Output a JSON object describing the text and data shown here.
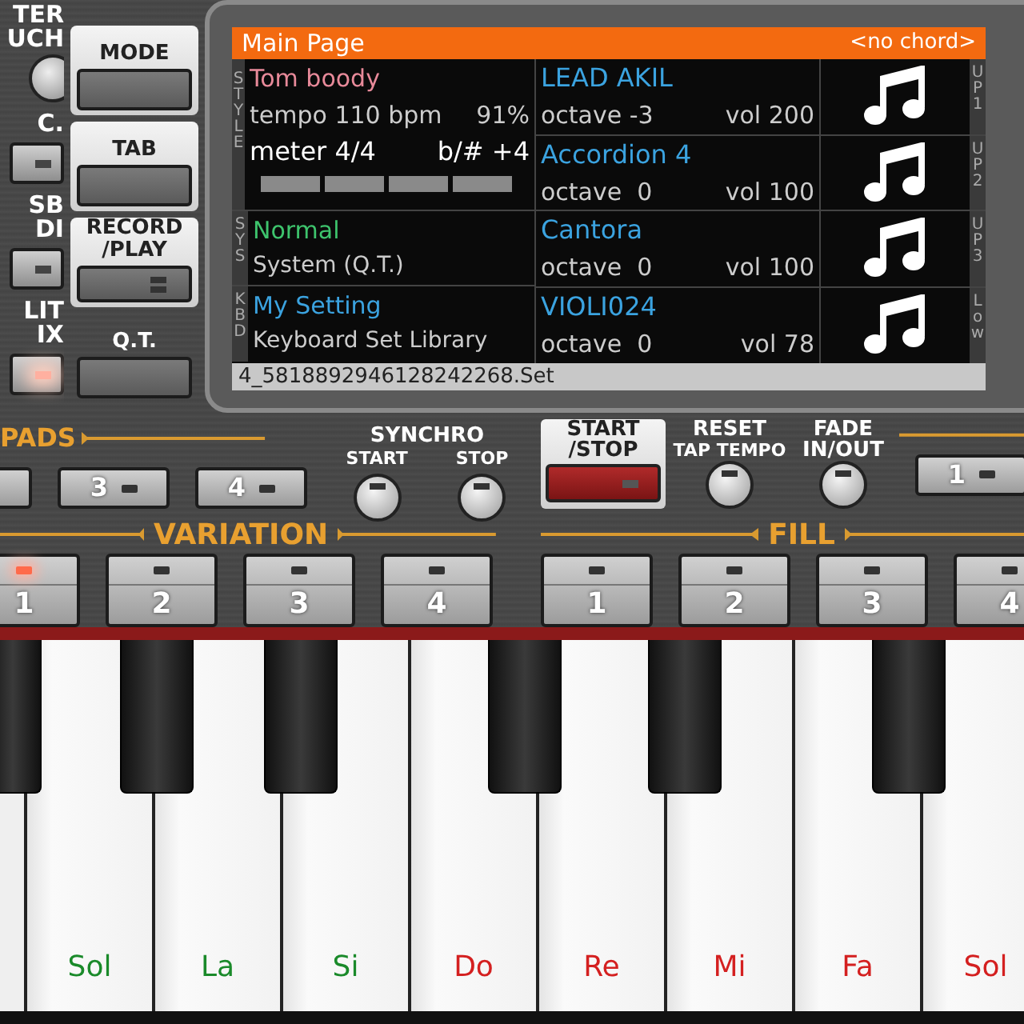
{
  "left_panel": [
    {
      "lines": [
        "TER",
        "UCH"
      ],
      "kind": "knob"
    },
    {
      "lines": [
        "C."
      ],
      "kind": "button",
      "lit": false
    },
    {
      "lines": [
        "SB",
        "DI"
      ],
      "kind": "button",
      "lit": false
    },
    {
      "lines": [
        "LIT",
        "IX"
      ],
      "kind": "button",
      "lit": true
    }
  ],
  "side_buttons": [
    {
      "lines": [
        "MODE"
      ],
      "kind": "plain"
    },
    {
      "lines": [
        "TAB"
      ],
      "kind": "plain"
    },
    {
      "lines": [
        "RECORD",
        "/PLAY"
      ],
      "kind": "led"
    },
    {
      "lines": [
        "Q.T."
      ],
      "kind": "plain"
    }
  ],
  "display": {
    "title": "Main Page",
    "chord": "<no chord>",
    "style": {
      "side": "STYLE",
      "name": "Tom boody",
      "tempo": "tempo 110 bpm",
      "percent": "91%",
      "meter": "meter 4/4",
      "transpose": "b/# +4"
    },
    "sys": {
      "side": "SYS",
      "name": "Normal",
      "detail": "System (Q.T.)"
    },
    "kbd": {
      "side": "KBD",
      "name": "My Setting",
      "detail": "Keyboard Set Library"
    },
    "parts": [
      {
        "side": "UP1",
        "name": "LEAD AKIL",
        "octave": "octave -3",
        "vol": "vol 200"
      },
      {
        "side": "UP2",
        "name": "Accordion 4",
        "octave": "octave  0",
        "vol": "vol 100"
      },
      {
        "side": "UP3",
        "name": "Cantora",
        "octave": "octave  0",
        "vol": "vol 100"
      },
      {
        "side": "Low",
        "name": "VIOLI024",
        "octave": "octave  0",
        "vol": "vol 78"
      }
    ],
    "file": "4_5818892946128242268.Set"
  },
  "pads": {
    "label": "PADS",
    "buttons": [
      "3",
      "4"
    ]
  },
  "synchro": {
    "label": "SYNCHRO",
    "knobs": [
      "START",
      "STOP"
    ]
  },
  "start_stop": {
    "lines": [
      "START",
      "/STOP"
    ]
  },
  "reset": {
    "lines": [
      "RESET",
      "TAP TEMPO"
    ]
  },
  "fade": {
    "lines": [
      "FADE",
      "IN/OUT"
    ]
  },
  "right_pad": {
    "label": "1"
  },
  "variation": {
    "label": "VARIATION",
    "buttons": [
      {
        "label": "1",
        "lit": true
      },
      {
        "label": "2",
        "lit": false
      },
      {
        "label": "3",
        "lit": false
      },
      {
        "label": "4",
        "lit": false
      }
    ]
  },
  "fill": {
    "label": "FILL",
    "buttons": [
      {
        "label": "1",
        "lit": false
      },
      {
        "label": "2",
        "lit": false
      },
      {
        "label": "3",
        "lit": false
      },
      {
        "label": "4",
        "lit": false
      }
    ]
  },
  "keys": [
    {
      "label": "Sol",
      "color": "#1a8a2a"
    },
    {
      "label": "La",
      "color": "#1a8a2a"
    },
    {
      "label": "Si",
      "color": "#1a8a2a"
    },
    {
      "label": "Do",
      "color": "#d42020"
    },
    {
      "label": "Re",
      "color": "#d42020"
    },
    {
      "label": "Mi",
      "color": "#d42020"
    },
    {
      "label": "Fa",
      "color": "#d42020"
    },
    {
      "label": "Sol",
      "color": "#d42020"
    }
  ]
}
